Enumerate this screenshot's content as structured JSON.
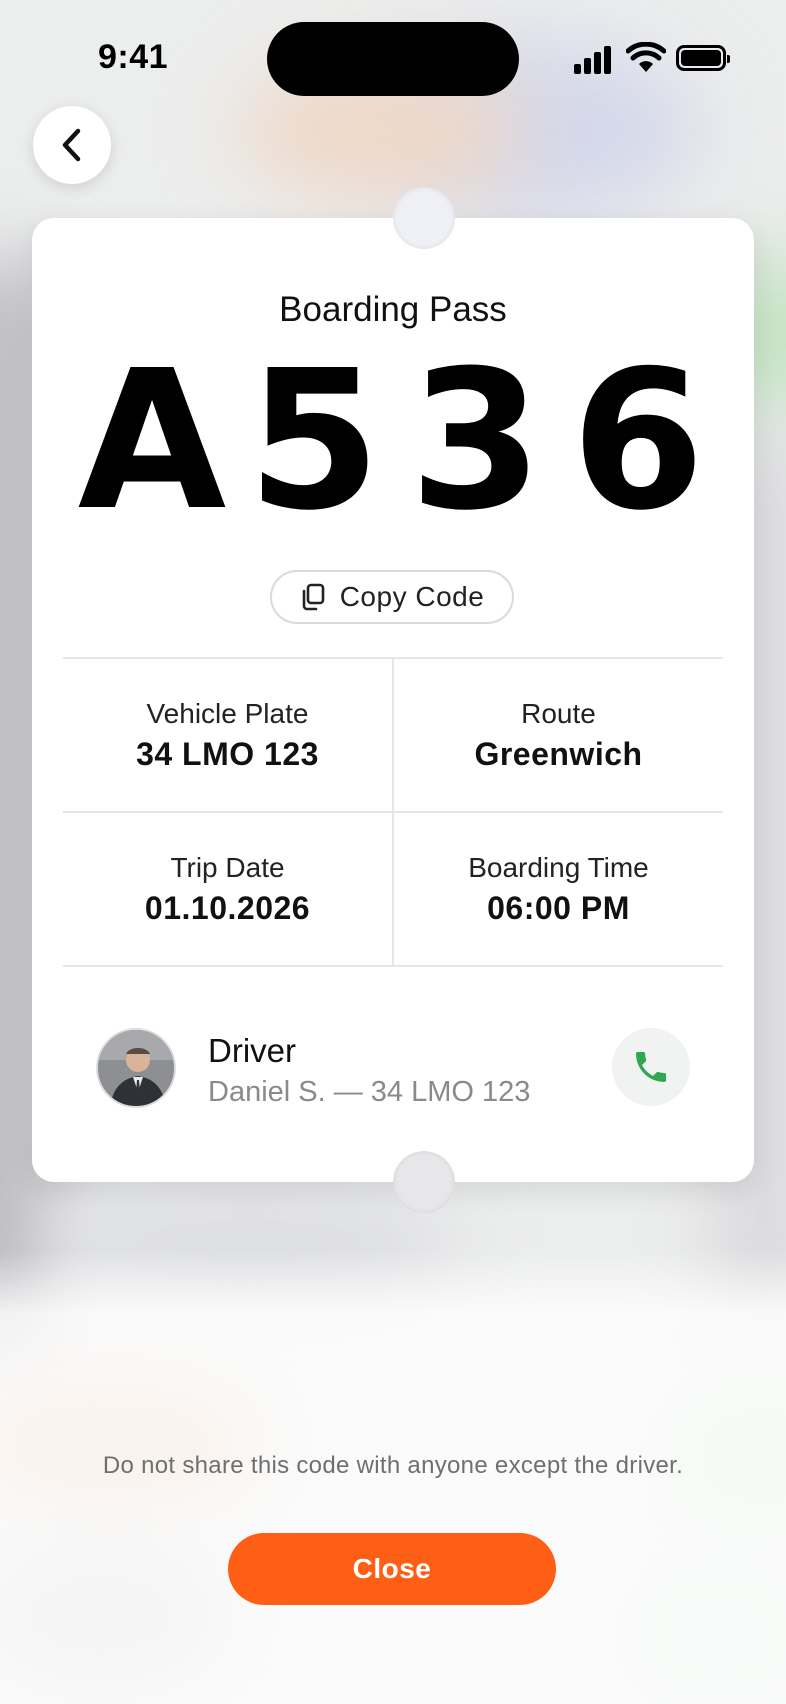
{
  "status_bar": {
    "time": "9:41"
  },
  "header": {
    "back_icon": "chevron-left-icon"
  },
  "pass": {
    "title": "Boarding Pass",
    "code_chars": [
      "A",
      "5",
      "3",
      "6"
    ],
    "copy_label": "Copy Code",
    "copy_icon": "copy-icon"
  },
  "details": [
    [
      {
        "label": "Vehicle Plate",
        "value": "34 LMO 123"
      },
      {
        "label": "Route",
        "value": "Greenwich"
      }
    ],
    [
      {
        "label": "Trip Date",
        "value": "01.10.2026"
      },
      {
        "label": "Boarding Time",
        "value": "06:00 PM"
      }
    ]
  ],
  "driver": {
    "title": "Driver",
    "subtitle": "Daniel S. — 34 LMO 123",
    "call_icon": "phone-icon",
    "call_color": "#2fa84f"
  },
  "footer": {
    "note": "Do not share this code with anyone except the driver.",
    "close_label": "Close",
    "accent": "#ff5f14"
  }
}
